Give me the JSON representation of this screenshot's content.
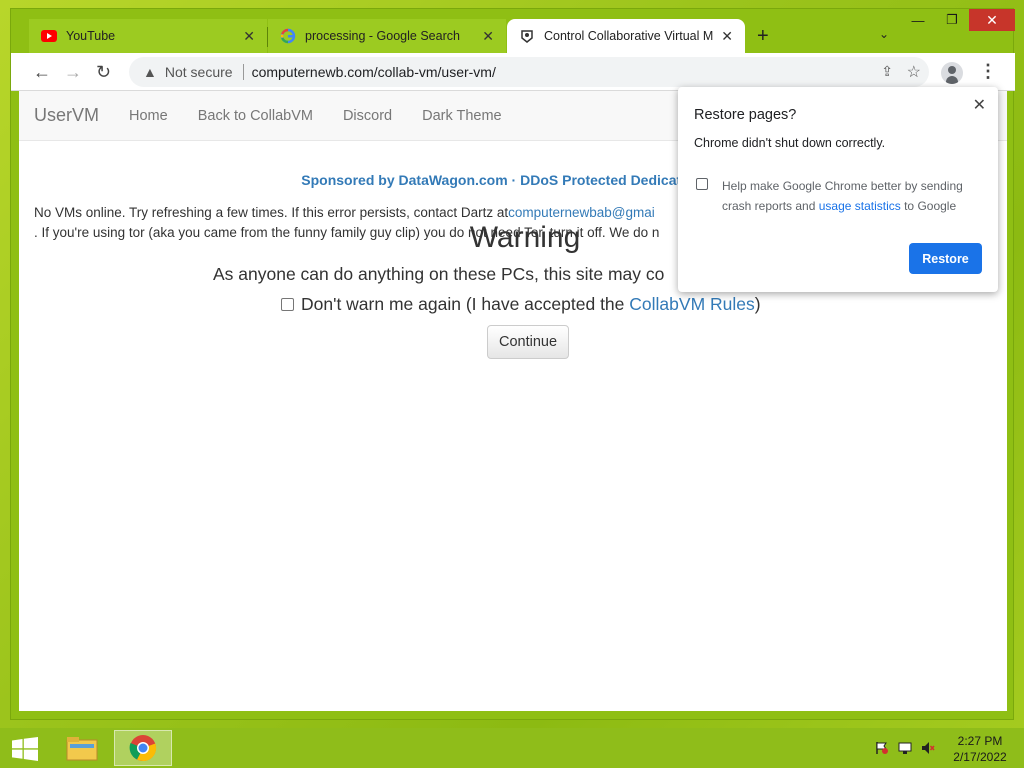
{
  "window": {
    "minimize_glyph": "—",
    "maximize_glyph": "❐",
    "close_glyph": "✕"
  },
  "tabs": [
    {
      "label": "YouTube",
      "icon": "youtube-icon"
    },
    {
      "label": "processing - Google Search",
      "icon": "google-icon"
    },
    {
      "label": "Control Collaborative Virtual Ma",
      "icon": "collabvm-icon",
      "active": true
    }
  ],
  "tab_close_glyph": "✕",
  "new_tab_glyph": "+",
  "tab_search_glyph": "⌄",
  "toolbar": {
    "back_glyph": "←",
    "forward_glyph": "→",
    "reload_glyph": "↻",
    "security_icon": "warning-icon",
    "security_glyph": "▲",
    "security_label": "Not secure",
    "url": "computernewb.com/collab-vm/user-vm/",
    "share_glyph": "⇪",
    "bookmark_glyph": "☆",
    "menu_glyph": "⋮"
  },
  "site_nav": {
    "brand": "UserVM",
    "links": [
      "Home",
      "Back to CollabVM",
      "Discord",
      "Dark Theme"
    ]
  },
  "sponsor": "Sponsored by DataWagon.com · DDoS Protected Dedicated & V",
  "offline": {
    "line1_prefix": "No VMs online. Try refreshing a few times. If this error persists, contact Dartz at",
    "email": "computernewbab@gmai",
    "line2": ". If you're using tor (aka you came from the funny family guy clip) you do not need Tor, turn it off. We do n"
  },
  "warning": {
    "title": "Warning",
    "text": "As anyone can do anything on these PCs, this site may co",
    "dont_warn_prefix": "Don't warn me again (I have accepted the ",
    "rules_link": "CollabVM Rules",
    "dont_warn_suffix": ")",
    "continue_label": "Continue"
  },
  "popup": {
    "title": "Restore pages?",
    "message": "Chrome didn't shut down correctly.",
    "checkbox_prefix": "Help make Google Chrome better by sending crash reports and ",
    "checkbox_link": "usage statistics",
    "checkbox_suffix": " to Google",
    "restore_label": "Restore",
    "close_glyph": "✕"
  },
  "taskbar": {
    "time": "2:27 PM",
    "date": "2/17/2022"
  },
  "colors": {
    "desktop_green": "#9cc41c",
    "link_blue": "#337ab7",
    "chrome_blue": "#1a73e8",
    "close_red": "#c7352a"
  }
}
